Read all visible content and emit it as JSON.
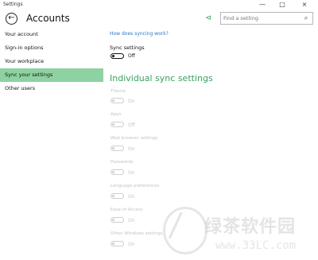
{
  "window": {
    "app_title": "Settings",
    "minimize_glyph": "—",
    "maximize_glyph": "□",
    "close_glyph": "×"
  },
  "header": {
    "back_glyph": "←",
    "title": "Accounts",
    "pin_glyph": "⊲",
    "search_placeholder": "Find a setting",
    "search_glyph": "⌕"
  },
  "sidebar": {
    "items": [
      {
        "label": "Your account"
      },
      {
        "label": "Sign-in options"
      },
      {
        "label": "Your workplace"
      },
      {
        "label": "Sync your settings",
        "selected": true
      },
      {
        "label": "Other users"
      }
    ]
  },
  "content": {
    "link": "How does syncing work?",
    "sync_label": "Sync settings",
    "sync_state": "Off",
    "section_title": "Individual sync settings",
    "settings": [
      {
        "label": "Theme",
        "state": "On"
      },
      {
        "label": "Apps",
        "state": "Off"
      },
      {
        "label": "Web browser settings",
        "state": "On"
      },
      {
        "label": "Passwords",
        "state": "On"
      },
      {
        "label": "Language preferences",
        "state": "On"
      },
      {
        "label": "Ease of Access",
        "state": "On"
      },
      {
        "label": "Other Windows settings",
        "state": "On"
      }
    ]
  },
  "watermark": {
    "text": "绿茶软件园",
    "url": "www.33LC.com"
  },
  "colors": {
    "accent": "#3aa060",
    "selected_bg": "#8ed2a1",
    "link": "#2b76c7",
    "disabled": "#c4c4c4"
  }
}
